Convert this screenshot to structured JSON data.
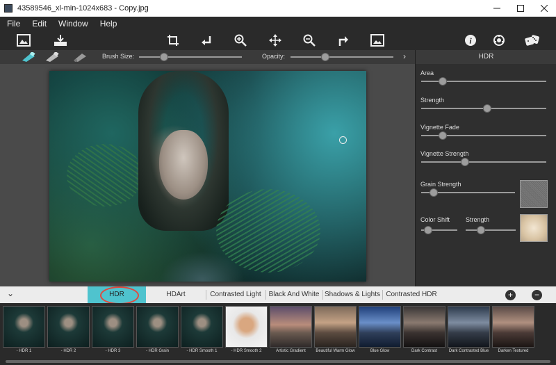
{
  "window": {
    "title": "43589546_xl-min-1024x683 - Copy.jpg"
  },
  "menu": [
    "File",
    "Edit",
    "Window",
    "Help"
  ],
  "toolbar": {
    "icons": [
      "open-image-icon",
      "save-icon",
      "crop-icon",
      "undo-icon",
      "zoom-in-icon",
      "move-icon",
      "zoom-out-icon",
      "redo-icon",
      "fit-image-icon",
      "info-icon",
      "settings-icon",
      "dice-icon"
    ]
  },
  "subbar": {
    "brush_size_label": "Brush Size:",
    "opacity_label": "Opacity:",
    "brush_size_value": 0.24,
    "opacity_value": 0.34
  },
  "panel": {
    "title": "HDR",
    "sliders": [
      {
        "label": "Area",
        "value": 0.17
      },
      {
        "label": "Strength",
        "value": 0.53
      },
      {
        "label": "Vignette Fade",
        "value": 0.17
      },
      {
        "label": "Vignette Strength",
        "value": 0.35
      },
      {
        "label": "Grain Strength",
        "value": 0.13
      },
      {
        "label": "Color Shift",
        "value": 0.2
      }
    ],
    "strength2_label": "Strength",
    "strength2_value": 0.3
  },
  "tabs": [
    "HDR",
    "HDArt",
    "Contrasted Light",
    "Black And White",
    "Shadows & Lights",
    "Contrasted HDR"
  ],
  "active_tab": "HDR",
  "thumbs": [
    {
      "caption": "- HDR 1"
    },
    {
      "caption": "- HDR 2"
    },
    {
      "caption": "- HDR 3"
    },
    {
      "caption": "- HDR Grain"
    },
    {
      "caption": "- HDR Smooth 1"
    },
    {
      "caption": "- HDR Smooth 2"
    },
    {
      "caption": "Artistic Gradient"
    },
    {
      "caption": "Beautiful Warm Glow"
    },
    {
      "caption": "Blue Glow"
    },
    {
      "caption": "Dark Contrast"
    },
    {
      "caption": "Dark Contrasted Blue"
    },
    {
      "caption": "Darken Textured"
    }
  ],
  "colors": {
    "accent": "#4fc3ce",
    "highlight_ring": "#e04a3f"
  }
}
